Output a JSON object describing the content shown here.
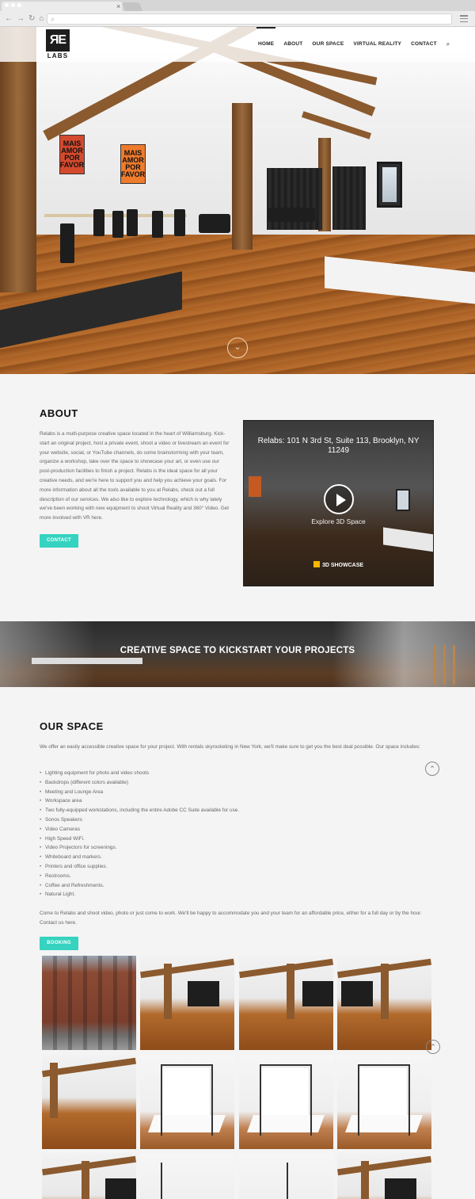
{
  "browser": {
    "tab_close": "×",
    "nav_glyphs": [
      "←",
      "→",
      "↻",
      "⌂"
    ],
    "search_icon": "magnifier"
  },
  "header": {
    "logo_mark": "ЯE",
    "logo_text": "LABS",
    "nav": [
      {
        "label": "HOME",
        "active": true
      },
      {
        "label": "ABOUT",
        "active": false
      },
      {
        "label": "OUR SPACE",
        "active": false
      },
      {
        "label": "VIRTUAL REALITY",
        "active": false
      },
      {
        "label": "CONTACT",
        "active": false
      }
    ],
    "search_icon": "search-icon"
  },
  "hero": {
    "poster_1": [
      "MAIS",
      "AMOR",
      "POR",
      "FAVOR"
    ],
    "poster_2": [
      "MAIS",
      "AMOR",
      "POR",
      "FAVOR"
    ],
    "scroll_icon": "⌄"
  },
  "about": {
    "title": "ABOUT",
    "body": "Relabs is a multi-purpose creative space located in the heart of Williamsburg. Kick-start an original project, host a private event, shoot a video or livestream an event for your website, social, or YouTube channels, do some brainstorming with your team, organize a workshop, take over the space to showcase your art, or even use our post-production facilities to finish a project. Relabs is the ideal space for all your creative needs, and we're here to support you and help you achieve your goals. For more information about all the tools available to you at Relabs, check out a full description of our services. We also like to explore technology, which is why lately we've been working with new equipment to shoot Virtual Reality and 360° Video. Get more involved with VR here.",
    "button": "CONTACT",
    "video": {
      "title": "Relabs: 101 N 3rd St, Suite 113, Brooklyn, NY 11249",
      "caption": "Explore 3D Space",
      "badge": "3D SHOWCASE"
    }
  },
  "banner": {
    "text": "CREATIVE SPACE TO KICKSTART YOUR PROJECTS"
  },
  "space": {
    "title": "OUR SPACE",
    "intro": "We offer an easily accessible creative space for your project. With rentals skyrocketing in New York, we'll make sure to get you the best deal possible. Our space includes:",
    "items": [
      "Lighting equipment for photo and video shoots",
      "Backdrops (different colors available)",
      "Meeting and Lounge Area",
      "Workspace area",
      "Two fully-equipped workstations, including the entire Adobe CC Suite available for use.",
      "Sonos Speakers",
      "Video Cameras",
      "High Speed WiFi.",
      "Video Projectors for screenings.",
      "Whiteboard and markers.",
      "Printers and office supplies.",
      "Restrooms.",
      "Coffee and Refreshments.",
      "Natural Light."
    ],
    "outro": "Come to Relabs and shoot video, photo or just come to work. We'll be happy to accommodate you and your team for an affordable price, either for a full day or by the hour. Contact us here.",
    "button": "BOOKING",
    "up_icon": "⌃"
  },
  "colors": {
    "accent": "#35d3c0",
    "text_dark": "#111111",
    "text_body": "#666666",
    "page_bg": "#f4f4f4"
  }
}
